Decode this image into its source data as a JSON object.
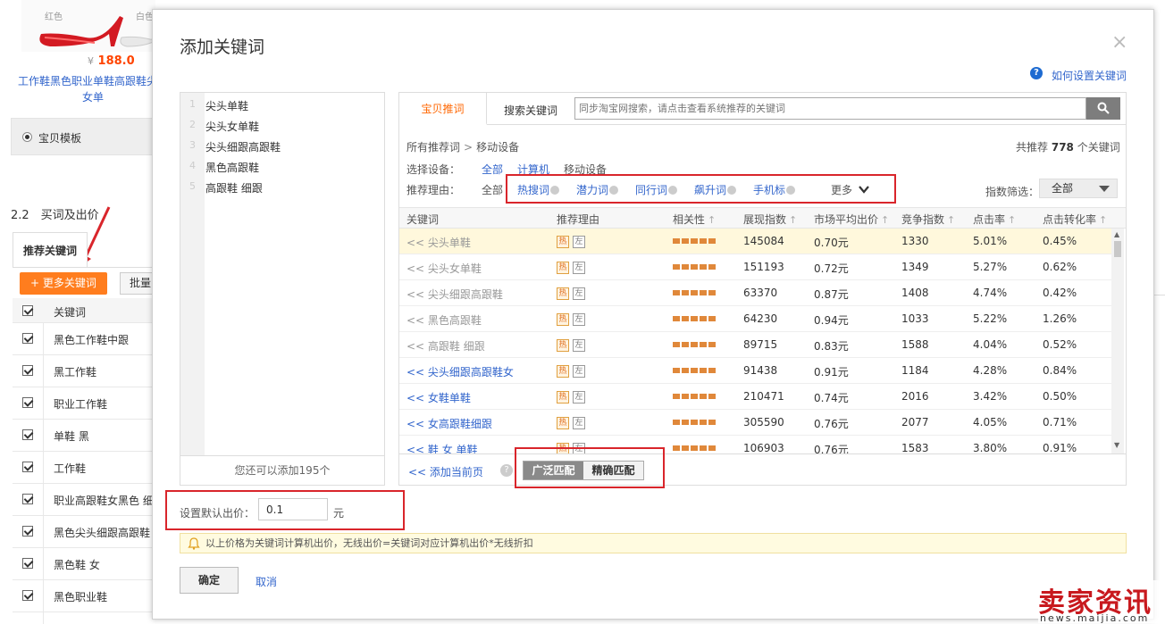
{
  "background": {
    "product": {
      "color_red": "红色",
      "color_white": "白色",
      "currency": "¥",
      "price": "188.0",
      "title": "工作鞋黑色职业单鞋高跟鞋尖头女单"
    },
    "template_label": "宝贝模板",
    "section_title": "2.2　买词及出价",
    "recommend_tab": "推荐关键词",
    "more_keywords_button": "更多关键词",
    "batch_button": "批量",
    "table_header": "关键词",
    "keywords": [
      "黑色工作鞋中跟",
      "黑工作鞋",
      "职业工作鞋",
      "单鞋 黑",
      "工作鞋",
      "职业高跟鞋女黑色 细",
      "黑色尖头细跟高跟鞋",
      "黑色鞋 女",
      "黑色职业鞋"
    ]
  },
  "dialog": {
    "title": "添加关键词",
    "close": "×",
    "help_link": "如何设置关键词",
    "selected_keywords": [
      "尖头单鞋",
      "尖头女单鞋",
      "尖头细跟高跟鞋",
      "黑色高跟鞋",
      "高跟鞋 细跟"
    ],
    "left_footer": "您还可以添加195个",
    "tabs": {
      "active": "宝贝推词",
      "search": "搜索关键词"
    },
    "search_placeholder": "同步淘宝网搜索，请点击查看系统推荐的关键词",
    "breadcrumb": {
      "root": "所有推荐词",
      "sep": ">",
      "current": "移动设备"
    },
    "total": {
      "prefix": "共推荐",
      "count": "778",
      "suffix": "个关键词"
    },
    "device": {
      "label": "选择设备：",
      "all": "全部",
      "pc": "计算机",
      "mobile": "移动设备"
    },
    "reason": {
      "label": "推荐理由：",
      "all": "全部",
      "hot": "热搜词",
      "potential": "潜力词",
      "peer": "同行词",
      "rising": "飙升词",
      "mobile_tag": "手机标",
      "more": "更多"
    },
    "index_filter": {
      "label": "指数筛选：",
      "value": "全部"
    },
    "columns": {
      "keyword": "关键词",
      "reason": "推荐理由",
      "relevance": "相关性",
      "impressions": "展现指数",
      "avg_bid": "市场平均出价",
      "competition": "竞争指数",
      "ctr": "点击率",
      "cvr": "点击转化率"
    },
    "tag_hot": "热",
    "tag_left": "左",
    "rows": [
      {
        "keyword": "<< 尖头单鞋",
        "added": true,
        "impressions": "145084",
        "avg_bid": "0.70元",
        "competition": "1330",
        "ctr": "5.01%",
        "cvr": "0.45%"
      },
      {
        "keyword": "<< 尖头女单鞋",
        "added": true,
        "impressions": "151193",
        "avg_bid": "0.72元",
        "competition": "1349",
        "ctr": "5.27%",
        "cvr": "0.62%"
      },
      {
        "keyword": "<< 尖头细跟高跟鞋",
        "added": true,
        "impressions": "63370",
        "avg_bid": "0.87元",
        "competition": "1408",
        "ctr": "4.74%",
        "cvr": "0.42%"
      },
      {
        "keyword": "<< 黑色高跟鞋",
        "added": true,
        "impressions": "64230",
        "avg_bid": "0.94元",
        "competition": "1033",
        "ctr": "5.22%",
        "cvr": "1.26%"
      },
      {
        "keyword": "<< 高跟鞋 细跟",
        "added": true,
        "impressions": "89715",
        "avg_bid": "0.83元",
        "competition": "1588",
        "ctr": "4.04%",
        "cvr": "0.52%"
      },
      {
        "keyword": "<< 尖头细跟高跟鞋女",
        "added": false,
        "impressions": "91438",
        "avg_bid": "0.91元",
        "competition": "1184",
        "ctr": "4.28%",
        "cvr": "0.84%"
      },
      {
        "keyword": "<< 女鞋单鞋",
        "added": false,
        "impressions": "210471",
        "avg_bid": "0.74元",
        "competition": "2016",
        "ctr": "3.42%",
        "cvr": "0.50%"
      },
      {
        "keyword": "<< 女高跟鞋细跟",
        "added": false,
        "impressions": "305590",
        "avg_bid": "0.76元",
        "competition": "2077",
        "ctr": "4.05%",
        "cvr": "0.71%"
      },
      {
        "keyword": "<< 鞋 女 单鞋",
        "added": false,
        "impressions": "106903",
        "avg_bid": "0.76元",
        "competition": "1583",
        "ctr": "3.80%",
        "cvr": "0.91%"
      }
    ],
    "add_page": "<<  添加当前页",
    "match": {
      "broad": "广泛匹配",
      "exact": "精确匹配"
    },
    "bid": {
      "label": "设置默认出价：",
      "value": "0.1",
      "unit": "元"
    },
    "notice": "以上价格为关键词计算机出价，无线出价=关键词对应计算机出价*无线折扣",
    "ok": "确定",
    "cancel": "取消"
  },
  "watermark": {
    "main": "卖家资讯",
    "sub": "news.maijia.com"
  },
  "colors": {
    "accent_orange": "#ff6600",
    "link_blue": "#3366cc",
    "highlight_red": "#d9252b",
    "more_button": "#ff7d1e"
  }
}
